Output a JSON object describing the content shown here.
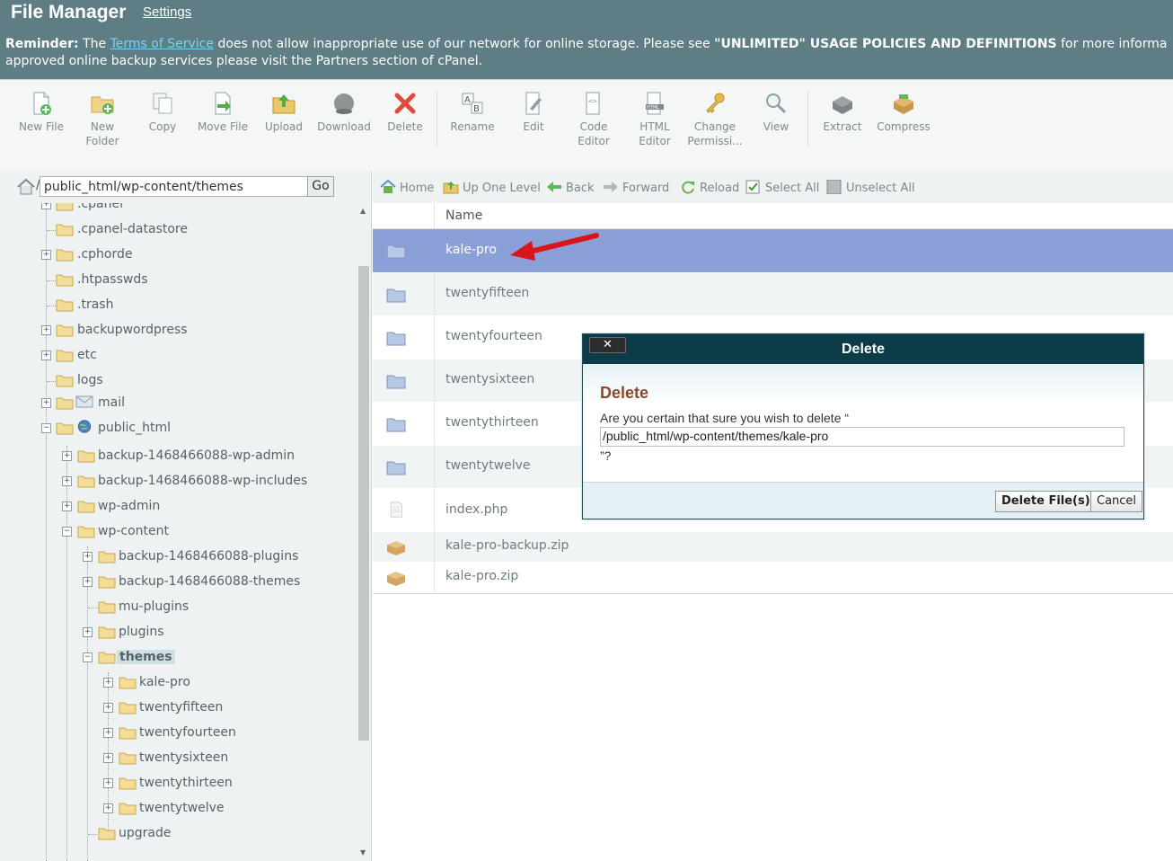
{
  "header": {
    "app_title": "File Manager",
    "settings_link": "Settings",
    "reminder_label": "Reminder:",
    "reminder_text_1": "The",
    "reminder_tos_link": "Terms of Service",
    "reminder_text_2": "does not allow inappropriate use of our network for online storage. Please see",
    "reminder_policy": "\"UNLIMITED\" USAGE POLICIES AND DEFINITIONS",
    "reminder_text_3": "for more informa",
    "reminder_line_2": "approved online backup services please visit the Partners section of cPanel."
  },
  "toolbar": {
    "buttons": [
      {
        "label": "New File",
        "icon": "new-file-icon"
      },
      {
        "label": "New Folder",
        "icon": "new-folder-icon"
      },
      {
        "label": "Copy",
        "icon": "copy-icon"
      },
      {
        "label": "Move File",
        "icon": "move-file-icon"
      },
      {
        "label": "Upload",
        "icon": "upload-icon"
      },
      {
        "label": "Download",
        "icon": "download-icon"
      },
      {
        "label": "Delete",
        "icon": "delete-icon"
      },
      {
        "label": "Rename",
        "icon": "rename-icon"
      },
      {
        "label": "Edit",
        "icon": "edit-icon"
      },
      {
        "label": "Code Editor",
        "icon": "code-editor-icon"
      },
      {
        "label": "HTML Editor",
        "icon": "html-editor-icon"
      },
      {
        "label": "Change Permissi...",
        "icon": "change-permissions-icon"
      },
      {
        "label": "View",
        "icon": "view-icon"
      },
      {
        "label": "Extract",
        "icon": "extract-icon"
      },
      {
        "label": "Compress",
        "icon": "compress-icon"
      }
    ]
  },
  "tree": {
    "path_value": "public_html/wp-content/themes",
    "go_label": "Go",
    "items": [
      {
        "label": ".cpanel",
        "expandable": true
      },
      {
        "label": ".cpanel-datastore",
        "expandable": false
      },
      {
        "label": ".cphorde",
        "expandable": true
      },
      {
        "label": ".htpasswds",
        "expandable": false
      },
      {
        "label": ".trash",
        "expandable": false
      },
      {
        "label": "backupwordpress",
        "expandable": true
      },
      {
        "label": "etc",
        "expandable": true
      },
      {
        "label": "logs",
        "expandable": false
      },
      {
        "label": "mail",
        "expandable": true
      },
      {
        "label": "public_html",
        "expandable": true
      },
      {
        "label": "backup-1468466088-wp-admin",
        "expandable": true
      },
      {
        "label": "backup-1468466088-wp-includes",
        "expandable": true
      },
      {
        "label": "wp-admin",
        "expandable": true
      },
      {
        "label": "wp-content",
        "expandable": true
      },
      {
        "label": "backup-1468466088-plugins",
        "expandable": true
      },
      {
        "label": "backup-1468466088-themes",
        "expandable": true
      },
      {
        "label": "mu-plugins",
        "expandable": false
      },
      {
        "label": "plugins",
        "expandable": true
      },
      {
        "label": "themes",
        "expandable": true
      },
      {
        "label": "kale-pro",
        "expandable": true
      },
      {
        "label": "twentyfifteen",
        "expandable": true
      },
      {
        "label": "twentyfourteen",
        "expandable": true
      },
      {
        "label": "twentysixteen",
        "expandable": true
      },
      {
        "label": "twentythirteen",
        "expandable": true
      },
      {
        "label": "twentytwelve",
        "expandable": true
      },
      {
        "label": "upgrade",
        "expandable": false
      }
    ]
  },
  "nav": {
    "home": "Home",
    "up_one_level": "Up One Level",
    "back": "Back",
    "forward": "Forward",
    "reload": "Reload",
    "select_all": "Select All",
    "unselect_all": "Unselect All"
  },
  "files": {
    "column_name": "Name",
    "rows": [
      {
        "name": "kale-pro",
        "type": "folder",
        "selected": true
      },
      {
        "name": "twentyfifteen",
        "type": "folder"
      },
      {
        "name": "twentyfourteen",
        "type": "folder"
      },
      {
        "name": "twentysixteen",
        "type": "folder"
      },
      {
        "name": "twentythirteen",
        "type": "folder"
      },
      {
        "name": "twentytwelve",
        "type": "folder"
      },
      {
        "name": "index.php",
        "type": "file"
      },
      {
        "name": "kale-pro-backup.zip",
        "type": "archive"
      },
      {
        "name": "kale-pro.zip",
        "type": "archive"
      }
    ]
  },
  "dialog": {
    "close_label": "✕",
    "title": "Delete",
    "heading": "Delete",
    "question": "Are you certain that sure you wish to delete “",
    "path": "/public_html/wp-content/themes/kale-pro",
    "question_end": "”?",
    "delete_button": "Delete File(s)",
    "cancel_button": "Cancel"
  },
  "colors": {
    "header_bg": "#5f7d85",
    "selected_row": "#8ba0d6",
    "dialog_title_bg": "#0c3c48",
    "dialog_heading": "#8b4a2b",
    "arrow": "#d9141b"
  }
}
